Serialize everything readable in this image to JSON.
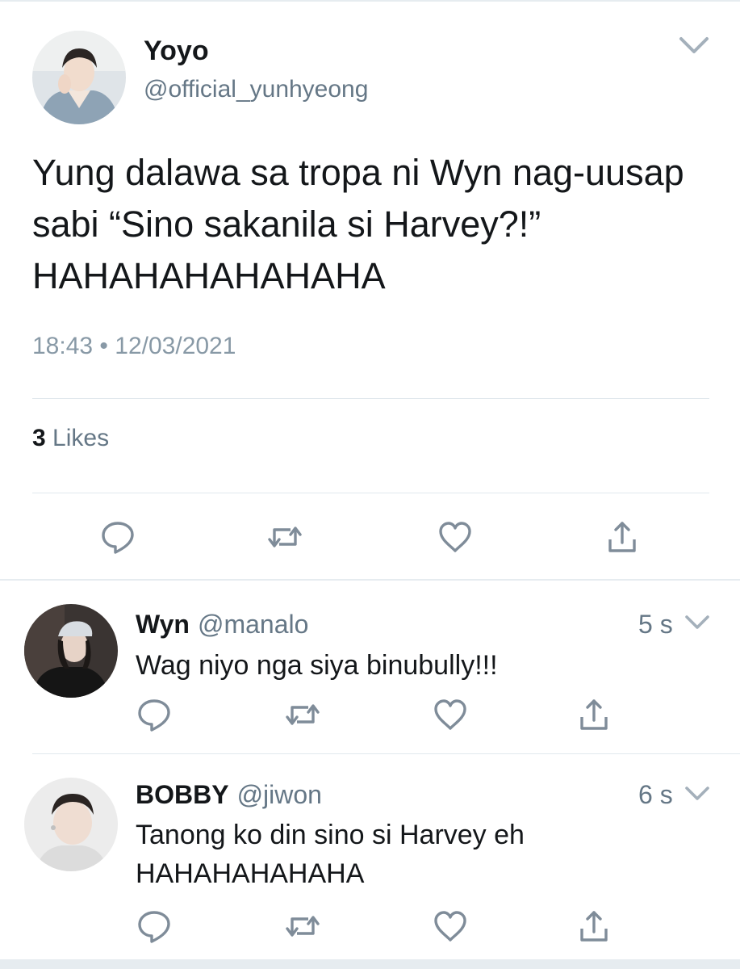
{
  "main_tweet": {
    "name": "Yoyo",
    "handle": "@official_yunhyeong",
    "text": "Yung dalawa sa tropa ni Wyn nag-uusap sabi “Sino sakanila si Harvey?!” HAHAHAHAHAHAHA",
    "time": "18:43",
    "separator": "•",
    "date": "12/03/2021",
    "likes_count": "3",
    "likes_label": "Likes",
    "avatar_icon": "profile-photo",
    "menu_icon": "chevron-down-icon"
  },
  "replies": [
    {
      "name": "Wyn",
      "handle": "@manalo",
      "time": "5 s",
      "text": "Wag niyo nga siya binubully!!!",
      "avatar_icon": "profile-photo"
    },
    {
      "name": "BOBBY",
      "handle": "@jiwon",
      "time": "6 s",
      "text": "Tanong ko din sino si Harvey eh HAHAHAHAHAHA",
      "avatar_icon": "profile-photo"
    }
  ],
  "actions": [
    "reply-icon",
    "retweet-icon",
    "like-icon",
    "share-icon"
  ],
  "colors": {
    "text": "#14171a",
    "secondary": "#657786",
    "meta": "#8899a6",
    "icon": "#7f8c99",
    "divider": "#e1e8ed"
  }
}
